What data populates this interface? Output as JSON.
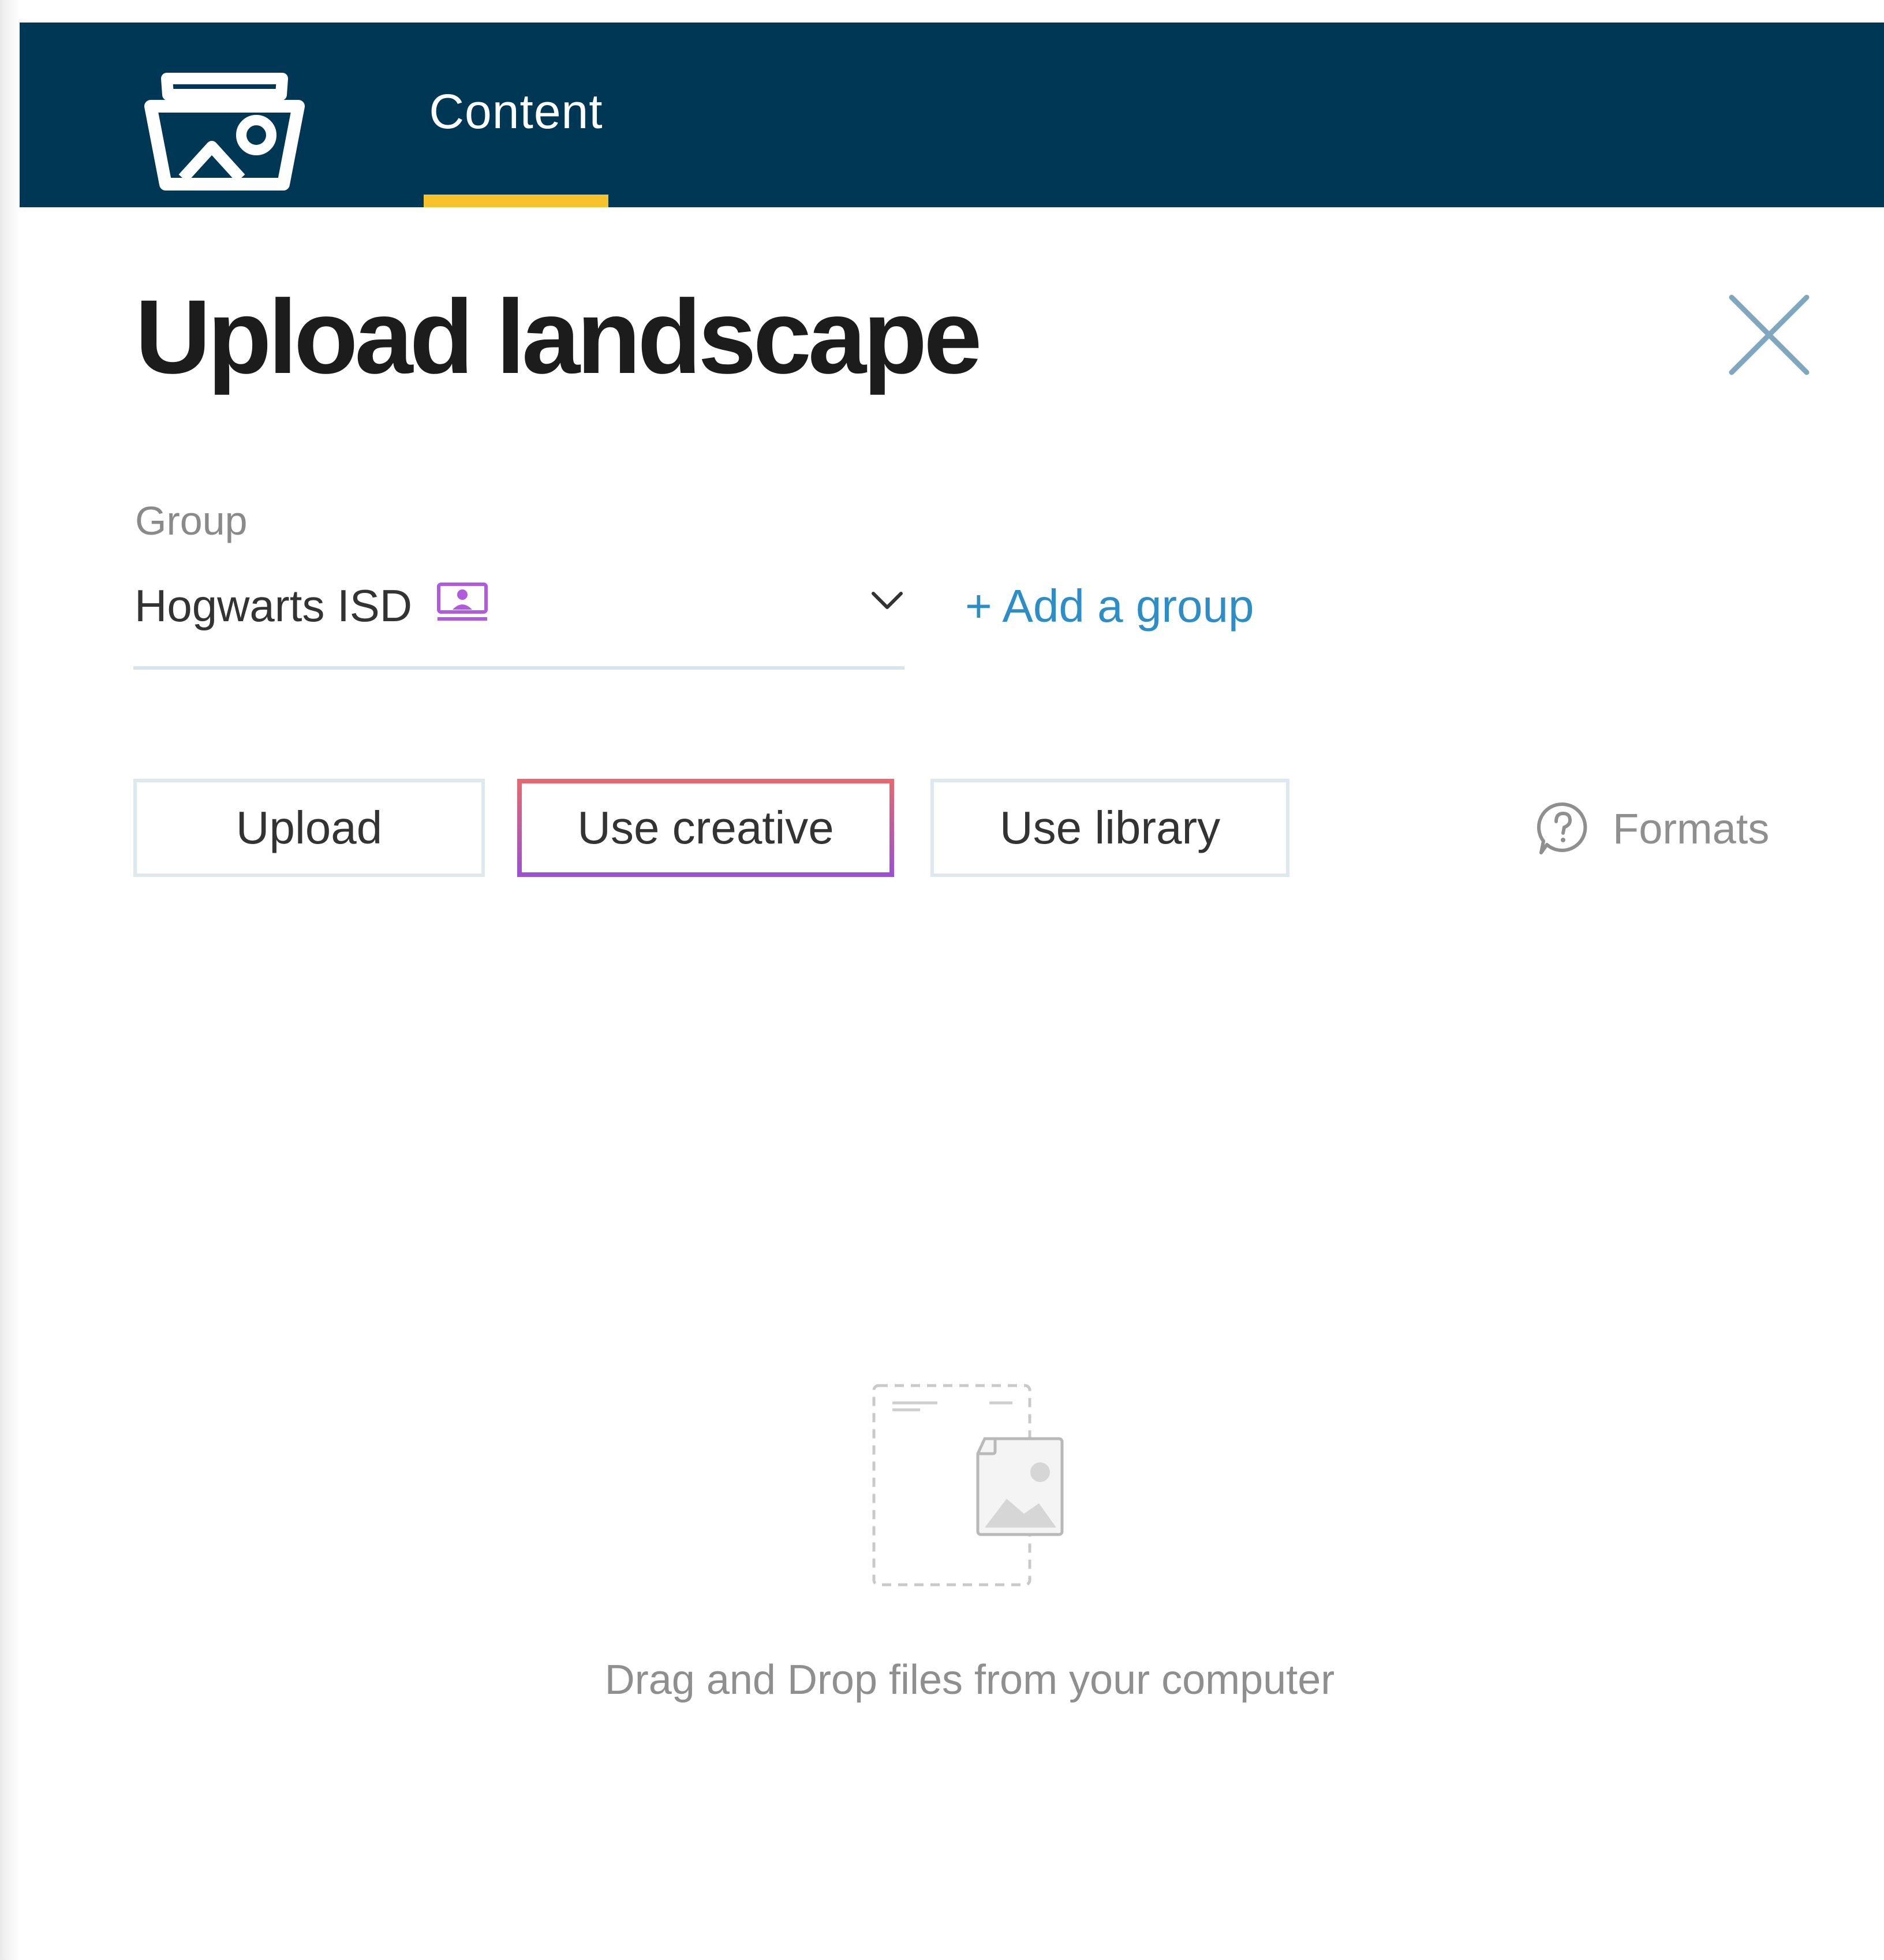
{
  "header": {
    "logo_icon": "media-folder-icon",
    "tab": {
      "label": "Content",
      "active": true
    },
    "colors": {
      "background": "#003755",
      "active_tab_underline": "#f6c32c"
    }
  },
  "dialog": {
    "title": "Upload landscape",
    "close_icon": "close-icon"
  },
  "group": {
    "label": "Group",
    "selected": "Hogwarts ISD",
    "selected_icon": "classroom-screen-icon",
    "add_group_label": "+ Add a group"
  },
  "source_buttons": {
    "upload": "Upload",
    "use_creative": "Use creative",
    "use_library": "Use library"
  },
  "formats": {
    "label": "Formats",
    "icon": "help-circle-icon"
  },
  "dropzone": {
    "icon": "file-image-placeholder-icon",
    "text": "Drag and Drop files from your computer"
  }
}
